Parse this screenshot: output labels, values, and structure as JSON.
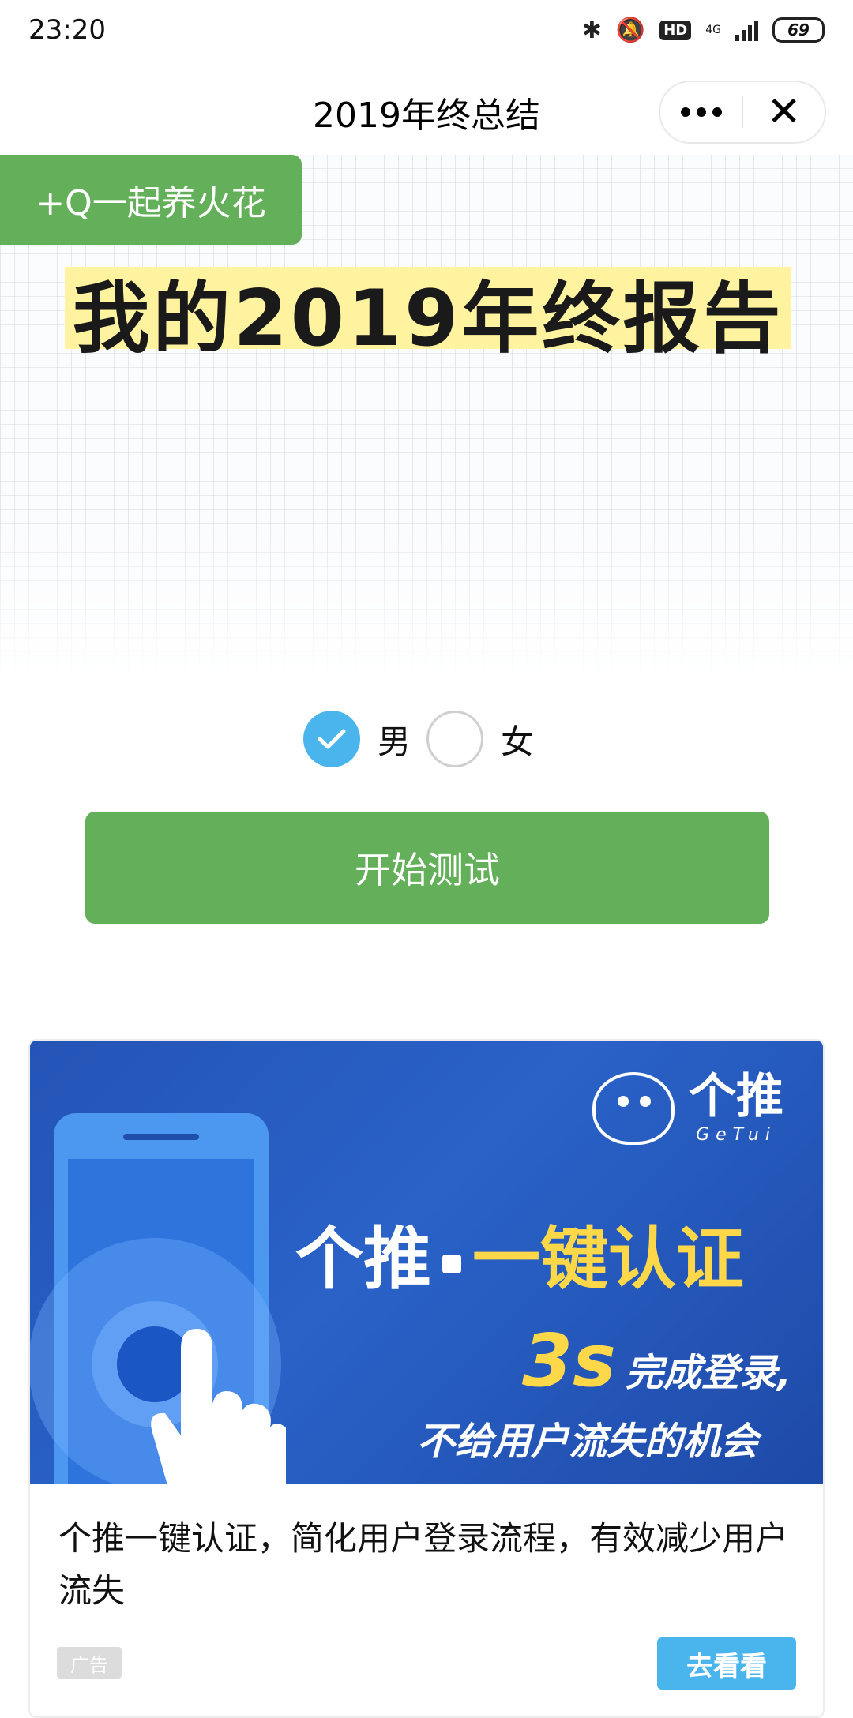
{
  "status_bar": {
    "time": "23:20",
    "hd_badge": "HD",
    "network": "4G",
    "battery": "69",
    "icons": [
      "bluetooth-icon",
      "mute-icon",
      "hd-icon",
      "signal-icon",
      "battery-icon"
    ]
  },
  "nav": {
    "title": "2019年终总结",
    "more_icon": "more-dots-icon",
    "close_icon": "close-icon"
  },
  "hero": {
    "follow_button": "+Q一起养火花",
    "title": "我的2019年终报告"
  },
  "gender": {
    "options": [
      {
        "label": "男",
        "checked": true
      },
      {
        "label": "女",
        "checked": false
      }
    ]
  },
  "start_button": "开始测试",
  "ad": {
    "brand_cn": "个推",
    "brand_en": "GeTui",
    "headline_white": "个推",
    "headline_yellow": "一键认证",
    "sub_highlight": "3s",
    "sub_line1": "完成登录,",
    "sub_line2": "不给用户流失的机会",
    "description": "个推一键认证，简化用户登录流程，有效减少用户流失",
    "tag": "广告",
    "cta": "去看看"
  },
  "colors": {
    "primary_green": "#64b05a",
    "radio_blue": "#4ab5ed",
    "ad_blue": "#2a62c8",
    "ad_yellow": "#ffd84a",
    "highlight_yellow": "#fff3a0"
  }
}
